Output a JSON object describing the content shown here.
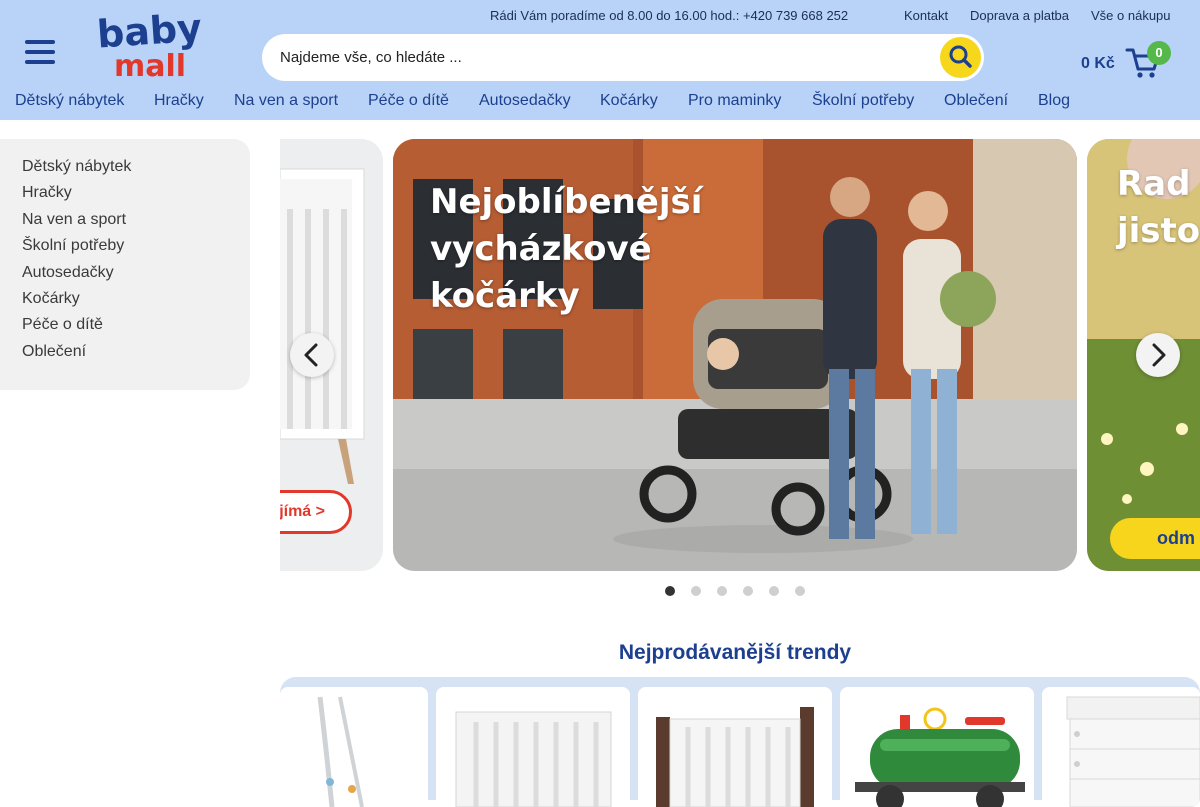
{
  "brand": {
    "logo_line1": "baby",
    "logo_line2": "mall",
    "colors": {
      "header_bg": "#b8d3f7",
      "brand_blue": "#1d3f8f",
      "accent_yellow": "#f7d71c",
      "accent_red": "#e2382b",
      "badge_green": "#55b84a"
    }
  },
  "header": {
    "info": "Rádi Vám poradíme od 8.00 do 16.00 hod.: +420 739 668 252",
    "links": [
      "Kontakt",
      "Doprava a platba",
      "Vše o nákupu"
    ],
    "search_placeholder": "Najdeme vše, co hledáte ...",
    "cart_amount": "0 Kč",
    "cart_count": "0",
    "menu_icon": "hamburger-menu-icon",
    "search_icon": "search-icon",
    "cart_icon": "shopping-cart-icon"
  },
  "nav": [
    "Dětský nábytek",
    "Hračky",
    "Na ven a sport",
    "Péče o dítě",
    "Autosedačky",
    "Kočárky",
    "Pro maminky",
    "Školní potřeby",
    "Oblečení",
    "Blog"
  ],
  "sidebar": [
    "Dětský nábytek",
    "Hračky",
    "Na ven a sport",
    "Školní potřeby",
    "Autosedačky",
    "Kočárky",
    "Péče o dítě",
    "Oblečení"
  ],
  "carousel": {
    "main_title_lines": [
      "Nejoblíbenější",
      "vycházkové",
      "kočárky"
    ],
    "right_title_lines": [
      "Rad",
      "jisto"
    ],
    "left_cta": "jímá >",
    "right_cta": "odm",
    "prev_icon": "chevron-left-icon",
    "next_icon": "chevron-right-icon",
    "slide_count": 6,
    "active_slide": 1
  },
  "trends": {
    "title": "Nejprodávanější trendy",
    "products": [
      "baby-bouncer",
      "white-crib",
      "brown-crib",
      "green-tractor-tank",
      "white-changing-dresser"
    ]
  }
}
